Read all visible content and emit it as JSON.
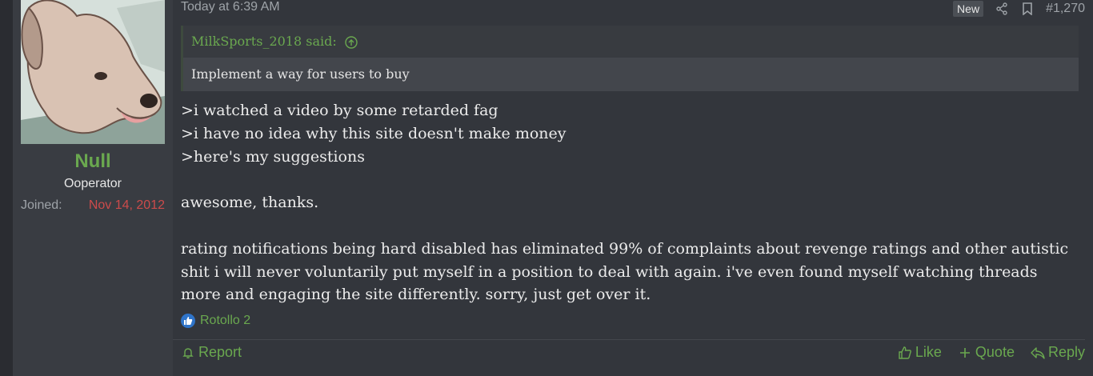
{
  "post": {
    "time": "Today at 6:39 AM",
    "badge_new": "New",
    "post_number": "#1,270",
    "icons": {
      "share": "share-icon",
      "bookmark": "bookmark-icon",
      "quote_jump": "arrow-up-circle-icon",
      "like": "thumbs-up-icon",
      "reply": "reply-icon",
      "report": "bell-icon"
    },
    "colors": {
      "accent_green": "#6aa84f",
      "joined_red": "#cc4b4b",
      "reaction_blue": "#2f74c9"
    }
  },
  "user": {
    "name": "Null",
    "title": "Ooperator",
    "joined_label": "Joined:",
    "joined_value": "Nov 14, 2012"
  },
  "quote": {
    "author": "MilkSports_2018 said:",
    "text": "Implement a way for users to buy"
  },
  "body": {
    "line1": ">i watched a video by some retarded fag",
    "line2": ">i have no idea why this site doesn't make money",
    "line3": ">here's my suggestions",
    "line4": "awesome, thanks.",
    "line5": "rating notifications being hard disabled has eliminated 99% of complaints about revenge ratings and other autistic shit i will never voluntarily put myself in a position to deal with again. i've even found myself watching threads more and engaging the site differently. sorry, just get over it."
  },
  "reactions": {
    "text": "Rotollo 2"
  },
  "footer": {
    "report": "Report",
    "like": "Like",
    "quote": "Quote",
    "reply": "Reply"
  }
}
